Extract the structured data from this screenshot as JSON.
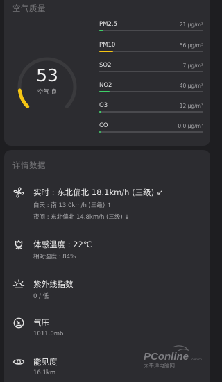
{
  "air_quality": {
    "section_title": "空气质量",
    "aqi_value": "53",
    "aqi_label": "空气 良",
    "aqi_level_fraction": 0.14,
    "pollutants": [
      {
        "name": "PM2.5",
        "value": "21 μg/m³",
        "fill": 0.04,
        "color": "#3ecf67"
      },
      {
        "name": "PM10",
        "value": "56 μg/m³",
        "fill": 0.13,
        "color": "#f5c514"
      },
      {
        "name": "SO2",
        "value": "7 μg/m³",
        "fill": 0.0,
        "color": "#3ecf67"
      },
      {
        "name": "NO2",
        "value": "40 μg/m³",
        "fill": 0.1,
        "color": "#3ecf67"
      },
      {
        "name": "O3",
        "value": "12 μg/m³",
        "fill": 0.02,
        "color": "#3ecf67"
      },
      {
        "name": "CO",
        "value": "0.0 μg/m³",
        "fill": 0.01,
        "color": "#3ecf67"
      }
    ],
    "colors": {
      "gauge_track": "#3a3a3d",
      "gauge_fill": "#f5c514"
    }
  },
  "details": {
    "section_title": "详情数据",
    "wind": {
      "icon": "fan-icon",
      "main": "实时 : 东北偏北 18.1km/h (三级) ↙",
      "day": "白天 : 南 13.0km/h (三级) ↑",
      "night": "夜间 : 东北偏北 14.8km/h (三级) ↓"
    },
    "feels_like": {
      "icon": "flower-icon",
      "main": "体感温度 : 22℃",
      "sub": "相对湿度 : 84%"
    },
    "uv": {
      "icon": "sun-icon",
      "main": "紫外线指数",
      "sub": "0 / 低"
    },
    "pressure": {
      "icon": "gauge-icon",
      "main": "气压",
      "sub": "1011.0mb"
    },
    "visibility": {
      "icon": "eye-icon",
      "main": "能见度",
      "sub": "16.1km"
    }
  },
  "watermark": {
    "brand": "PConline",
    "sub": "太平洋电脑网",
    "domain": ".com.cn"
  }
}
